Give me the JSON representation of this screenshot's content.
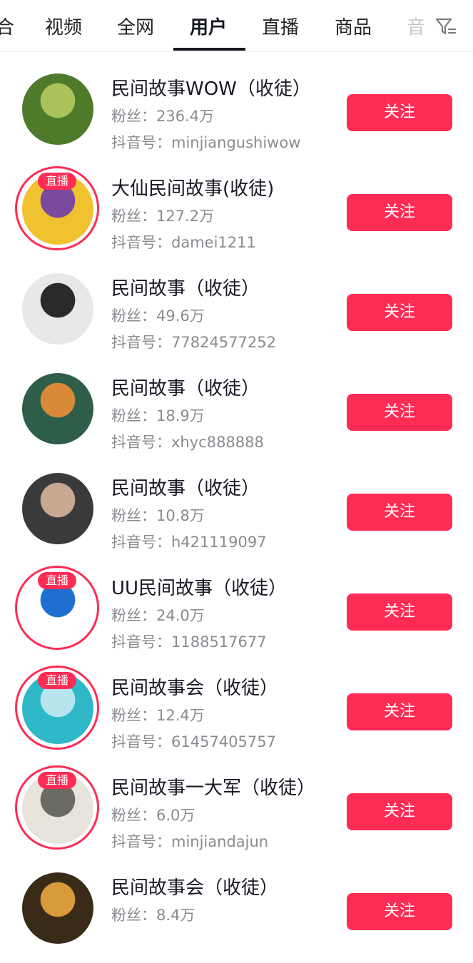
{
  "tabs": [
    {
      "label": "合"
    },
    {
      "label": "视频"
    },
    {
      "label": "全网"
    },
    {
      "label": "用户"
    },
    {
      "label": "直播"
    },
    {
      "label": "商品"
    },
    {
      "label": "音"
    }
  ],
  "active_tab": "用户",
  "filter_icon": "filter-icon",
  "live_badge_label": "直播",
  "users": [
    {
      "name": "民间故事WOW（收徒）",
      "fans": "粉丝：236.4万",
      "douyin_id": "抖音号：minjiangushiwow",
      "follow_label": "关注",
      "is_live": false,
      "avatar_colors": [
        "#4f7a2a",
        "#a9c35a"
      ]
    },
    {
      "name": "大仙民间故事(收徒)",
      "fans": "粉丝：127.2万",
      "douyin_id": "抖音号：damei1211",
      "follow_label": "关注",
      "is_live": true,
      "avatar_colors": [
        "#f0c230",
        "#7a4a9e"
      ]
    },
    {
      "name": "民间故事（收徒）",
      "fans": "粉丝：49.6万",
      "douyin_id": "抖音号：77824577252",
      "follow_label": "关注",
      "is_live": false,
      "avatar_colors": [
        "#e8e8e8",
        "#2a2a2a"
      ]
    },
    {
      "name": "民间故事（收徒）",
      "fans": "粉丝：18.9万",
      "douyin_id": "抖音号：xhyc888888",
      "follow_label": "关注",
      "is_live": false,
      "avatar_colors": [
        "#2e5e4a",
        "#d88a3a"
      ]
    },
    {
      "name": "民间故事（收徒）",
      "fans": "粉丝：10.8万",
      "douyin_id": "抖音号：h421119097",
      "follow_label": "关注",
      "is_live": false,
      "avatar_colors": [
        "#3a3a3a",
        "#c8a890"
      ]
    },
    {
      "name": "UU民间故事（收徒）",
      "fans": "粉丝：24.0万",
      "douyin_id": "抖音号：1188517677",
      "follow_label": "关注",
      "is_live": true,
      "avatar_colors": [
        "#ffffff",
        "#1f6fd1"
      ]
    },
    {
      "name": "民间故事会（收徒）",
      "fans": "粉丝：12.4万",
      "douyin_id": "抖音号：61457405757",
      "follow_label": "关注",
      "is_live": true,
      "avatar_colors": [
        "#2fb8c8",
        "#b8e4ee"
      ]
    },
    {
      "name": "民间故事一大军（收徒）",
      "fans": "粉丝：6.0万",
      "douyin_id": "抖音号：minjiandajun",
      "follow_label": "关注",
      "is_live": true,
      "avatar_colors": [
        "#e8e4dc",
        "#6a6a62"
      ]
    },
    {
      "name": "民间故事会（收徒）",
      "fans": "粉丝：8.4万",
      "douyin_id": "",
      "follow_label": "关注",
      "is_live": false,
      "avatar_colors": [
        "#3a2a18",
        "#d89a3a"
      ]
    }
  ]
}
